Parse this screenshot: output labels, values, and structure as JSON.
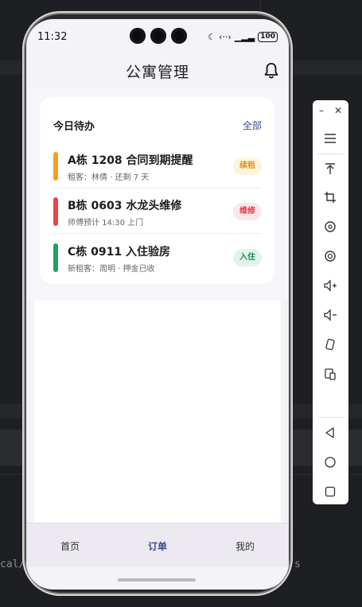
{
  "ide": {
    "left_text": "cal/",
    "right_text": "s"
  },
  "status_bar": {
    "time": "11:32",
    "battery": "100"
  },
  "app": {
    "title": "公寓管理"
  },
  "todo_card": {
    "title": "今日待办",
    "all_link": "全部",
    "tasks": [
      {
        "title": "A栋 1208 合同到期提醒",
        "subtitle": "租客：林倩 · 还剩 7 天",
        "tag": "续租",
        "bar_color": "#f2a31b",
        "tag_bg": "#fdf3dc",
        "tag_color": "#e0961a"
      },
      {
        "title": "B栋 0603 水龙头维修",
        "subtitle": "师傅预计 14:30 上门",
        "tag": "维修",
        "bar_color": "#e54848",
        "tag_bg": "#fde6e8",
        "tag_color": "#d83c4a"
      },
      {
        "title": "C栋 0911 入住验房",
        "subtitle": "新租客：周明 · 押金已收",
        "tag": "入住",
        "bar_color": "#21a065",
        "tag_bg": "#e2f4ea",
        "tag_color": "#1e8a57"
      }
    ]
  },
  "tabs": [
    {
      "label": "首页",
      "active": false
    },
    {
      "label": "订单",
      "active": true
    },
    {
      "label": "我的",
      "active": false
    }
  ],
  "colors": {
    "accent": "#3b4a8c"
  },
  "toolbar_icons": [
    "menu-icon",
    "upload-icon",
    "crop-icon",
    "rotate-left-icon",
    "rotate-right-icon",
    "volume-up-icon",
    "volume-down-icon",
    "shake-icon",
    "multi-device-icon",
    "back-icon",
    "home-icon",
    "overview-icon"
  ]
}
